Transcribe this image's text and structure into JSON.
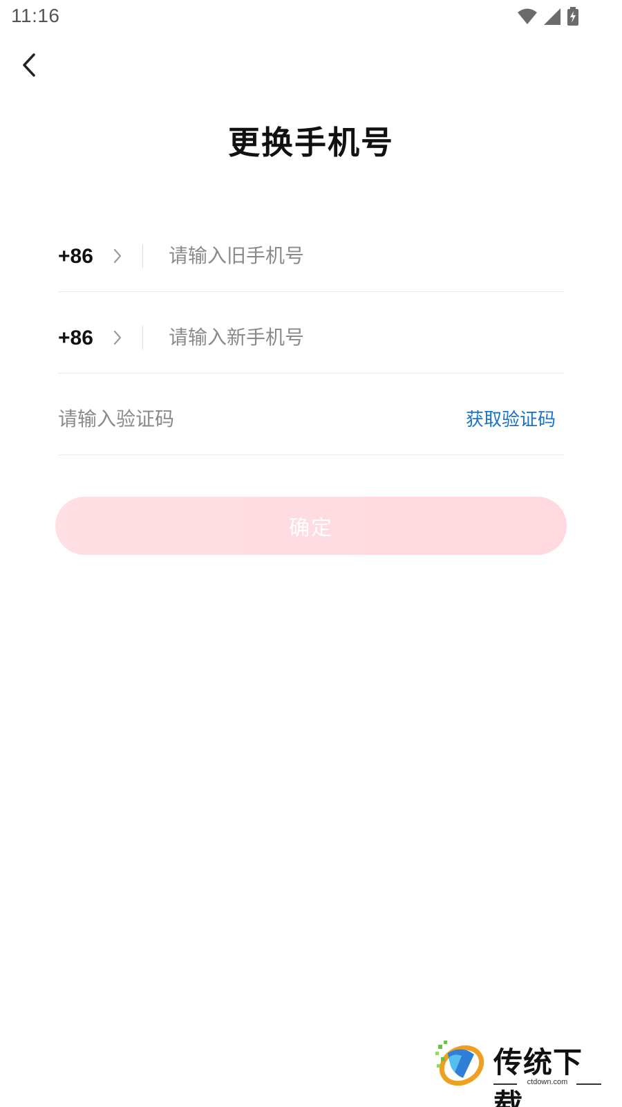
{
  "status_bar": {
    "time": "11:16",
    "icons": [
      "wifi-icon",
      "signal-icon",
      "battery-charging-icon"
    ]
  },
  "nav": {
    "back_icon": "chevron-left-icon"
  },
  "page": {
    "title": "更换手机号"
  },
  "form": {
    "old_phone": {
      "country_code": "+86",
      "placeholder": "请输入旧手机号",
      "value": ""
    },
    "new_phone": {
      "country_code": "+86",
      "placeholder": "请输入新手机号",
      "value": ""
    },
    "verification": {
      "placeholder": "请输入验证码",
      "value": "",
      "get_code_label": "获取验证码"
    },
    "confirm_label": "确定"
  },
  "watermark": {
    "brand": "传统下载",
    "domain": "ctdown.com"
  },
  "colors": {
    "link": "#1a73c8",
    "confirm_bg": "#ffdfe3",
    "title": "#111111",
    "placeholder": "#8a8a8a"
  }
}
